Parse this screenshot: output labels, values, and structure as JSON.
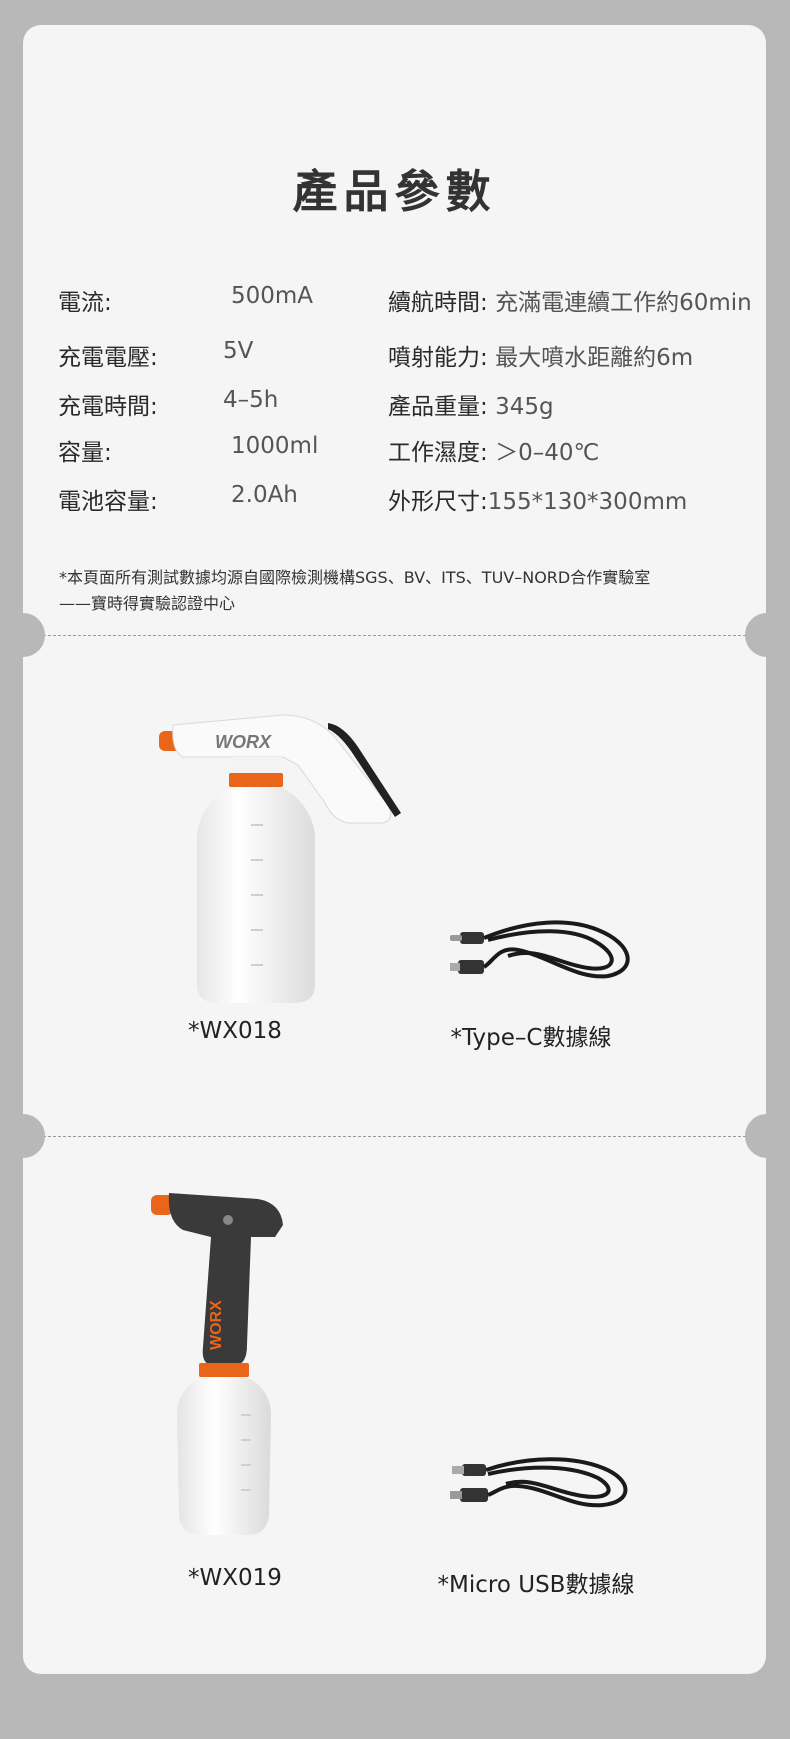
{
  "title": "產品參數",
  "specs_left": [
    {
      "label": "電流:",
      "value": "500mA"
    },
    {
      "label": "充電電壓:",
      "value": "5V"
    },
    {
      "label": "充電時間:",
      "value": "4–5h"
    },
    {
      "label": "容量:",
      "value": "1000ml"
    },
    {
      "label": "電池容量:",
      "value": "2.0Ah"
    }
  ],
  "specs_right": [
    {
      "label": "續航時間:",
      "value": "充滿電連續工作約60min"
    },
    {
      "label": "噴射能力:",
      "value": "最大噴水距離約6m"
    },
    {
      "label": "產品重量:",
      "value": "345g"
    },
    {
      "label": "工作濕度:",
      "value": "＞0–40℃"
    },
    {
      "label": "外形尺寸:",
      "value": "155*130*300mm"
    }
  ],
  "note": {
    "line1": "*本頁面所有測試數據均源自國際檢測機構SGS、BV、ITS、TUV–NORD合作實驗室",
    "line2": "——寶時得實驗認證中心"
  },
  "products": {
    "wx018": {
      "caption": "*WX018",
      "brand": "WORX"
    },
    "cable_typec": {
      "caption": "*Type–C數據線"
    },
    "wx019": {
      "caption": "*WX019",
      "brand": "WORX"
    },
    "cable_micro": {
      "caption": "*Micro USB數據線"
    }
  },
  "colors": {
    "accent": "#e8651a",
    "background": "#f5f5f5",
    "outer": "#b8b8b8"
  }
}
